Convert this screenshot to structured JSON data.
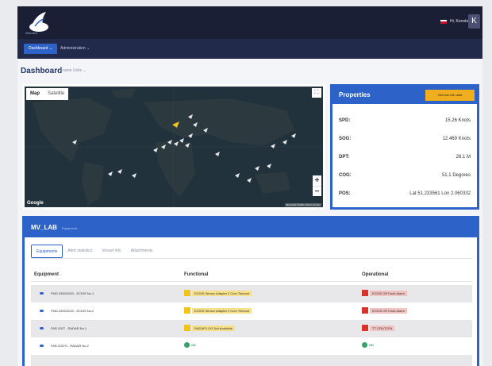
{
  "app": {
    "logo_text": "NemAce",
    "greeting": "Hi, Kenobe",
    "avatar_letter": "K"
  },
  "nav": {
    "dashboard": "Dashboard ⌄",
    "administration": "Administration ⌄"
  },
  "page": {
    "title": "Dashboard",
    "subtitle": "Frame Units ⌄"
  },
  "map": {
    "mode_map": "Map",
    "mode_satellite": "Satellite",
    "zoom_in": "+",
    "zoom_out": "−",
    "google": "Google",
    "attribution": "Map data ©2020 | Terms of Use"
  },
  "properties": {
    "title": "Properties",
    "button": "Get last 24h data",
    "rows": [
      {
        "key": "SPD:",
        "value": "15.26 Knots"
      },
      {
        "key": "SOG:",
        "value": "12.469 Knots"
      },
      {
        "key": "DPT:",
        "value": "26.1 M"
      },
      {
        "key": "COG:",
        "value": "51.1 Degrees"
      },
      {
        "key": "POS:",
        "value": "Lat 51.233561 Lon 2.060332"
      }
    ]
  },
  "vessel": {
    "name": "MV_LAB",
    "sub": "Equipment",
    "tabs": [
      "Equipments",
      "Alert statistics",
      "Vessel Info",
      "Attachments"
    ],
    "columns": {
      "equipment": "Equipment",
      "functional": "Functional",
      "operational": "Operational"
    },
    "rows": [
      {
        "name": "FMD-3300/3200 - ECDIS No.1",
        "functional": "ECDIS Sensor Adapter 2 Com Timeout",
        "operational": "ECDIS Off Track Alarm"
      },
      {
        "name": "FMD-3300/3200 - ECDIS No.2",
        "functional": "ECDIS Sensor Adapter 2 Com Timeout",
        "operational": "ECDIS Off Track Alarm"
      },
      {
        "name": "FAR-2027 - RADAR No.1",
        "functional": "RADAR LOG Not Available",
        "operational": "TT CPA/TCPA"
      },
      {
        "name": "FAR-2037S - RADAR No.2",
        "functional": "OK",
        "operational": "OK"
      }
    ]
  },
  "colors": {
    "brand": "#2d63c8",
    "warn": "#f0c419",
    "error": "#d9342b",
    "ok": "#3aa06a",
    "header": "#1a1f36"
  },
  "icons": [
    "logo-icon",
    "flag-icon",
    "fullscreen-icon",
    "vessel-arrow-icon",
    "status-warning-icon",
    "status-error-icon",
    "status-ok-icon"
  ]
}
